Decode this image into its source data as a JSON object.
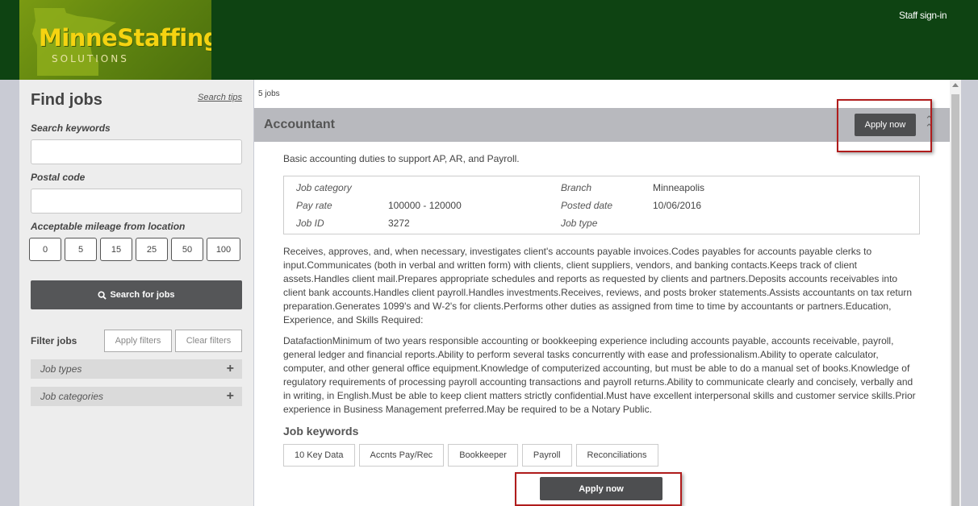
{
  "header": {
    "logo_title": "MinneStaffing",
    "logo_subtitle": "SOLUTIONS",
    "staff_signin": "Staff sign-in"
  },
  "sidebar": {
    "title": "Find jobs",
    "search_tips": "Search tips",
    "keywords_label": "Search keywords",
    "keywords_value": "",
    "postal_label": "Postal code",
    "postal_value": "",
    "mileage_label": "Acceptable mileage from location",
    "mileage_options": [
      "0",
      "5",
      "15",
      "25",
      "50",
      "100"
    ],
    "search_button": "Search for jobs",
    "filter_label": "Filter jobs",
    "apply_filters": "Apply filters",
    "clear_filters": "Clear filters",
    "job_types": "Job types",
    "job_categories": "Job categories"
  },
  "main": {
    "job_count": "5 jobs",
    "job": {
      "title": "Accountant",
      "apply_label": "Apply now",
      "summary": "Basic accounting duties to support AP, AR, and Payroll.",
      "info": {
        "job_category_label": "Job category",
        "job_category_value": "",
        "pay_rate_label": "Pay rate",
        "pay_rate_value": "100000 - 120000",
        "job_id_label": "Job ID",
        "job_id_value": "3272",
        "branch_label": "Branch",
        "branch_value": "Minneapolis",
        "posted_date_label": "Posted date",
        "posted_date_value": "10/06/2016",
        "job_type_label": "Job type",
        "job_type_value": ""
      },
      "description_1": "Receives, approves, and, when necessary, investigates client's accounts payable invoices.Codes payables for accounts payable clerks to input.Communicates (both in verbal and written form) with clients, client suppliers, vendors, and banking contacts.Keeps track of client assets.Handles client mail.Prepares appropriate schedules and reports as requested by clients and partners.Deposits accounts receivables into client bank accounts.Handles client payroll.Handles investments.Receives, reviews, and posts broker statements.Assists accountants on tax return preparation.Generates 1099's and W-2's for clients.Performs other duties as assigned from time to time by accountants or partners.Education, Experience, and Skills Required:",
      "description_2": "DatafactionMinimum of two years responsible accounting or bookkeeping experience including accounts payable, accounts receivable, payroll, general ledger and financial reports.Ability to perform several tasks concurrently with ease and professionalism.Ability to operate calculator, computer, and other general office equipment.Knowledge of computerized accounting, but must be able to do a manual set of books.Knowledge of regulatory requirements of processing payroll accounting transactions and payroll returns.Ability to communicate clearly and concisely, verbally and in writing, in English.Must be able to keep client matters strictly confidential.Must have excellent interpersonal skills and customer service skills.Prior experience in Business Management preferred.May be required to be a Notary Public.",
      "keywords_title": "Job keywords",
      "keywords": [
        "10 Key Data",
        "Accnts Pay/Rec",
        "Bookkeeper",
        "Payroll",
        "Reconciliations"
      ]
    }
  },
  "icons": {
    "search": "search-icon",
    "plus": "plus-icon",
    "collapse": "chevron-up-icon",
    "logo_map": "minnesota-map-icon"
  },
  "colors": {
    "header_bg": "#0e4312",
    "logo_text": "#f5d311",
    "button_dark": "#4d4e50",
    "highlight": "#b01c1c"
  }
}
